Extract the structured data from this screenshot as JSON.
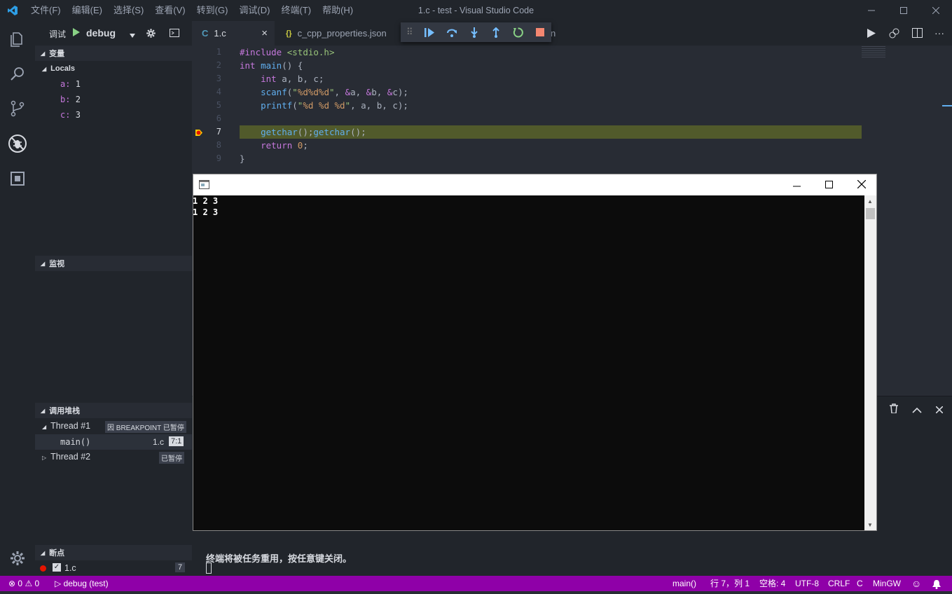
{
  "window": {
    "title": "1.c - test - Visual Studio Code"
  },
  "menu": [
    "文件(F)",
    "编辑(E)",
    "选择(S)",
    "查看(V)",
    "转到(G)",
    "调试(D)",
    "终端(T)",
    "帮助(H)"
  ],
  "debug_header": {
    "label": "调试",
    "config": "debug"
  },
  "variables": {
    "section": "变量",
    "scope": "Locals",
    "items": [
      {
        "name": "a",
        "value": "1"
      },
      {
        "name": "b",
        "value": "2"
      },
      {
        "name": "c",
        "value": "3"
      }
    ]
  },
  "watch": {
    "section": "监视"
  },
  "callstack": {
    "section": "调用堆栈",
    "thread1": {
      "name": "Thread #1",
      "badge": "因 BREAKPOINT 已暂停"
    },
    "frame": {
      "name": "main()",
      "file": "1.c",
      "pos": "7:1"
    },
    "thread2": {
      "name": "Thread #2",
      "badge": "已暂停"
    }
  },
  "breakpoints": {
    "section": "断点",
    "file": "1.c",
    "line": "7"
  },
  "tabs": [
    {
      "icon": "C",
      "label": "1.c",
      "close": "×"
    },
    {
      "icon": "{}",
      "label": "c_cpp_properties.json"
    },
    {
      "label": "n"
    }
  ],
  "code": {
    "line_numbers": [
      "1",
      "2",
      "3",
      "4",
      "5",
      "6",
      "7",
      "8",
      "9"
    ],
    "current_line": "7"
  },
  "console": {
    "output": [
      "1 2 3",
      "1 2 3"
    ]
  },
  "terminal": {
    "message": "终端将被任务重用，按任意键关闭。"
  },
  "status": {
    "errors": "0",
    "warnings": "0",
    "debug": "debug (test)",
    "function": "main()",
    "position": "行 7，列 1",
    "spaces": "空格: 4",
    "encoding": "UTF-8",
    "eol": "CRLF",
    "language": "C",
    "compiler": "MinGW"
  },
  "colors": {
    "statusbar": "#8f00a8",
    "highlight": "#515a2b",
    "accent": "#61afef"
  }
}
